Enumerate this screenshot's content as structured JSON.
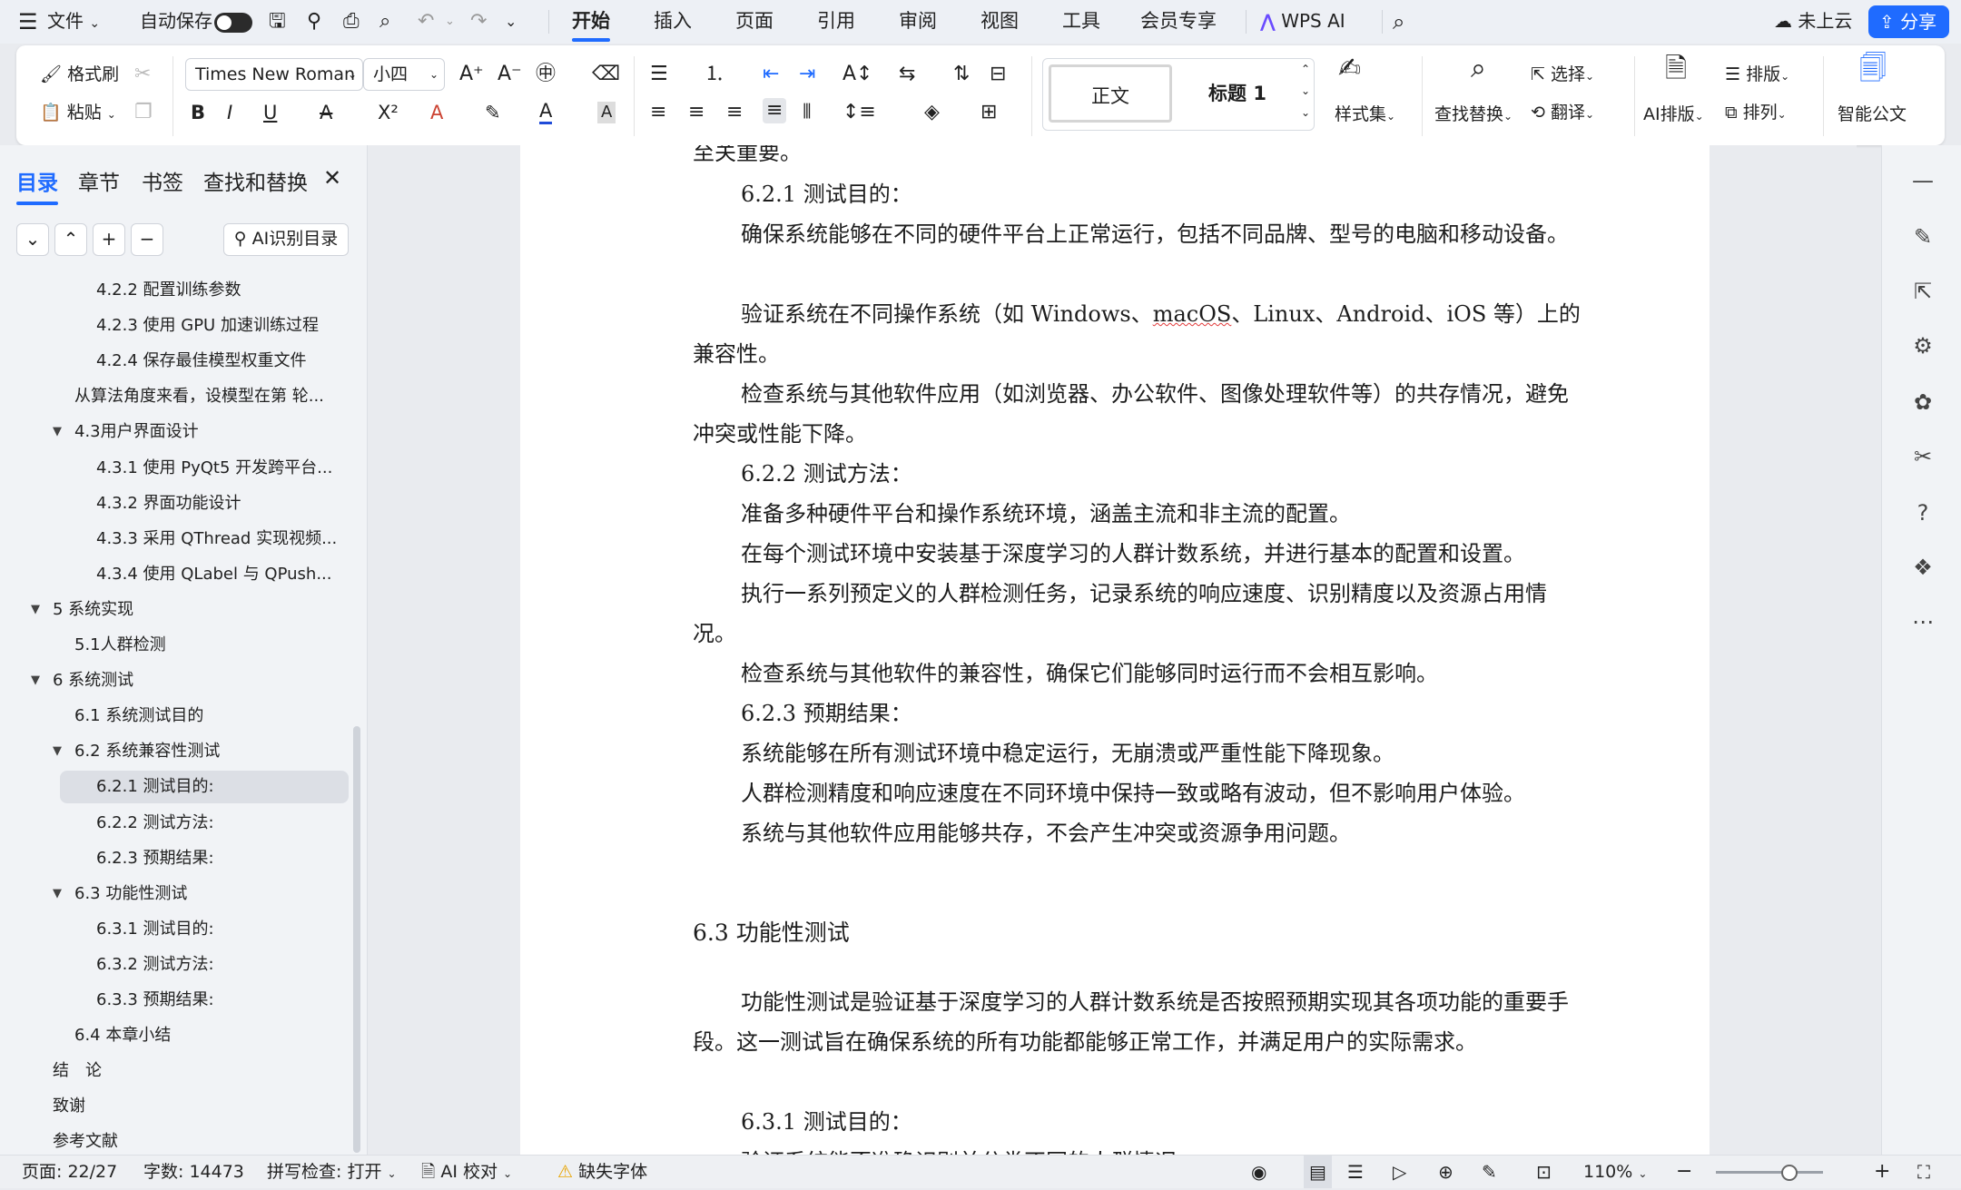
{
  "menubar": {
    "file": "文件",
    "autosave": "自动保存",
    "tabs": [
      "开始",
      "插入",
      "页面",
      "引用",
      "审阅",
      "视图",
      "工具",
      "会员专享"
    ],
    "active_tab": "开始",
    "wps_ai": "WPS AI",
    "cloud": "未上云",
    "share": "分享"
  },
  "ribbon": {
    "format_painter": "格式刷",
    "paste": "粘贴",
    "font_name": "Times New Roman",
    "font_size": "小四",
    "styles": {
      "normal": "正文",
      "heading1": "标题 1"
    },
    "style_set": "样式集",
    "find_replace": "查找替换",
    "select": "选择",
    "translate": "翻译",
    "ai_layout": "AI排版",
    "typeset": "排版",
    "arrange": "排列",
    "smart_doc": "智能公文",
    "accent_color": "#1f6bff"
  },
  "leftpane": {
    "tabs": [
      "目录",
      "章节",
      "书签",
      "查找和替换"
    ],
    "ai_toc": "AI识别目录",
    "toc": [
      {
        "label": "4.2.2 配置训练参数",
        "level": 3
      },
      {
        "label": "4.2.3 使用 GPU 加速训练过程",
        "level": 3
      },
      {
        "label": "4.2.4 保存最佳模型权重文件",
        "level": 3
      },
      {
        "label": "从算法角度来看，设模型在第 轮...",
        "level": 2
      },
      {
        "label": "4.3用户界面设计",
        "level": 2,
        "expanded": true
      },
      {
        "label": "4.3.1 使用 PyQt5 开发跨平台...",
        "level": 3
      },
      {
        "label": "4.3.2 界面功能设计",
        "level": 3
      },
      {
        "label": "4.3.3 采用 QThread 实现视频...",
        "level": 3
      },
      {
        "label": "4.3.4 使用 QLabel 与 QPush...",
        "level": 3
      },
      {
        "label": "5 系统实现",
        "level": 1,
        "expanded": true
      },
      {
        "label": "5.1人群检测",
        "level": 2
      },
      {
        "label": "6 系统测试",
        "level": 1,
        "expanded": true
      },
      {
        "label": "6.1 系统测试目的",
        "level": 2
      },
      {
        "label": "6.2 系统兼容性测试",
        "level": 2,
        "expanded": true
      },
      {
        "label": "6.2.1 测试目的:",
        "level": 3,
        "selected": true
      },
      {
        "label": "6.2.2 测试方法:",
        "level": 3
      },
      {
        "label": "6.2.3 预期结果:",
        "level": 3
      },
      {
        "label": "6.3 功能性测试",
        "level": 2,
        "expanded": true
      },
      {
        "label": "6.3.1 测试目的:",
        "level": 3
      },
      {
        "label": "6.3.2 测试方法:",
        "level": 3
      },
      {
        "label": "6.3.3 预期结果:",
        "level": 3
      },
      {
        "label": "6.4 本章小结",
        "level": 2
      },
      {
        "label": "结　论",
        "level": 1
      },
      {
        "label": "致谢",
        "level": 1
      },
      {
        "label": "参考文献",
        "level": 1
      }
    ]
  },
  "document": {
    "cut_top": "至关重要。",
    "h621": "6.2.1 测试目的：",
    "p1": "确保系统能够在不同的硬件平台上正常运行，包括不同品牌、型号的电脑和移动设备。",
    "p2a": "验证系统在不同操作系统（如 Windows、",
    "p2b": "macOS",
    "p2c": "、Linux、Android、iOS 等）上的兼容性。",
    "p3": "检查系统与其他软件应用（如浏览器、办公软件、图像处理软件等）的共存情况，避免冲突或性能下降。",
    "h622": "6.2.2 测试方法：",
    "p4": "准备多种硬件平台和操作系统环境，涵盖主流和非主流的配置。",
    "p5": "在每个测试环境中安装基于深度学习的人群计数系统，并进行基本的配置和设置。",
    "p6": "执行一系列预定义的人群检测任务，记录系统的响应速度、识别精度以及资源占用情况。",
    "p7": "检查系统与其他软件的兼容性，确保它们能够同时运行而不会相互影响。",
    "h623": "6.2.3 预期结果：",
    "p8": "系统能够在所有测试环境中稳定运行，无崩溃或严重性能下降现象。",
    "p9": "人群检测精度和响应速度在不同环境中保持一致或略有波动，但不影响用户体验。",
    "p10": "系统与其他软件应用能够共存，不会产生冲突或资源争用问题。",
    "h63": "6.3  功能性测试",
    "p11": "功能性测试是验证基于深度学习的人群计数系统是否按照预期实现其各项功能的重要手段。这一测试旨在确保系统的所有功能都能够正常工作，并满足用户的实际需求。",
    "h631": "6.3.1 测试目的：",
    "cut_bottom": "验证系统能否准确识别并分类不同的人群情况"
  },
  "statusbar": {
    "page": "页面: 22/27",
    "words": "字数: 14473",
    "spell": "拼写检查: 打开",
    "ai_check": "AI 校对",
    "missing_font": "缺失字体",
    "zoom": "110%"
  }
}
